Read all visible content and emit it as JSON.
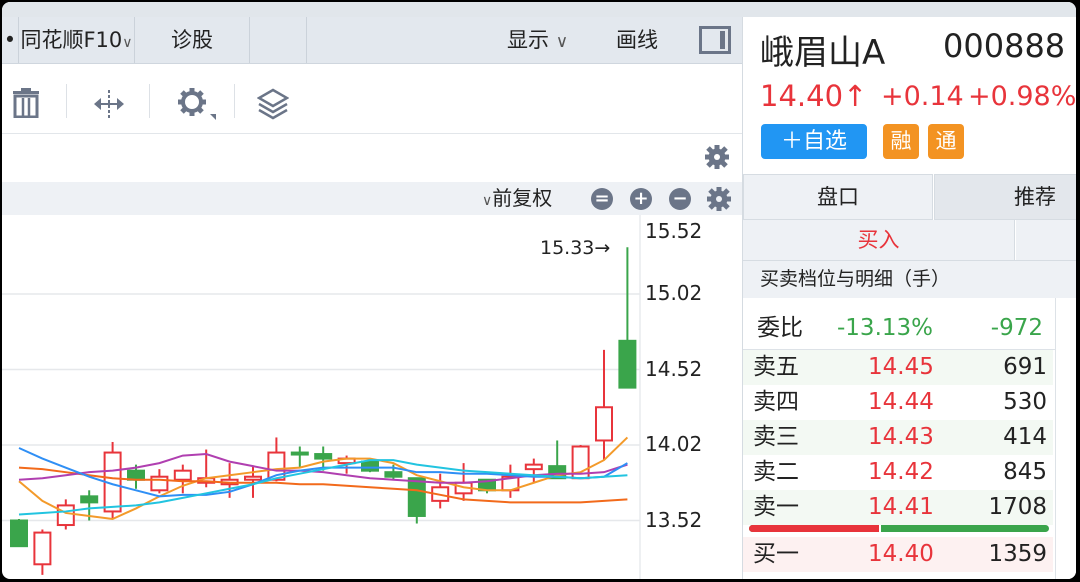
{
  "tabbar": {
    "dot": "•",
    "tabs": [
      "同花顺F10",
      "诊股"
    ],
    "f10_chevron": "∨",
    "display_label": "显示",
    "display_chevron": "∨",
    "draw_label": "画线"
  },
  "toolbar": {
    "icons": [
      "trash-icon",
      "split-arrows-icon",
      "gear-icon",
      "layers-icon"
    ]
  },
  "chart_header": {
    "adjust_label": "前复权",
    "adjust_chevron": "∨"
  },
  "chart_data": {
    "type": "candlestick",
    "y_ticks": [
      "15.52",
      "15.02",
      "14.52",
      "14.02",
      "13.52"
    ],
    "ylim": [
      13.2,
      15.6
    ],
    "max_annotation": "15.33→",
    "up_color": "#e8343b",
    "down_color": "#3aa54b",
    "candles": [
      {
        "o": 13.52,
        "c": 13.35,
        "h": 13.53,
        "l": 13.35
      },
      {
        "o": 13.23,
        "c": 13.44,
        "h": 13.46,
        "l": 13.16
      },
      {
        "o": 13.49,
        "c": 13.62,
        "h": 13.66,
        "l": 13.46
      },
      {
        "o": 13.68,
        "c": 13.64,
        "h": 13.72,
        "l": 13.52
      },
      {
        "o": 13.58,
        "c": 13.97,
        "h": 14.04,
        "l": 13.53
      },
      {
        "o": 13.85,
        "c": 13.79,
        "h": 13.89,
        "l": 13.73
      },
      {
        "o": 13.72,
        "c": 13.81,
        "h": 13.86,
        "l": 13.7
      },
      {
        "o": 13.79,
        "c": 13.85,
        "h": 13.89,
        "l": 13.7
      },
      {
        "o": 13.77,
        "c": 13.8,
        "h": 13.99,
        "l": 13.74
      },
      {
        "o": 13.76,
        "c": 13.79,
        "h": 13.9,
        "l": 13.67
      },
      {
        "o": 13.79,
        "c": 13.81,
        "h": 13.88,
        "l": 13.67
      },
      {
        "o": 13.79,
        "c": 13.97,
        "h": 14.07,
        "l": 13.78
      },
      {
        "o": 13.97,
        "c": 13.96,
        "h": 14.01,
        "l": 13.87
      },
      {
        "o": 13.96,
        "c": 13.93,
        "h": 14.01,
        "l": 13.85
      },
      {
        "o": 13.9,
        "c": 13.93,
        "h": 13.95,
        "l": 13.83
      },
      {
        "o": 13.91,
        "c": 13.85,
        "h": 13.93,
        "l": 13.84
      },
      {
        "o": 13.84,
        "c": 13.81,
        "h": 13.89,
        "l": 13.79
      },
      {
        "o": 13.8,
        "c": 13.55,
        "h": 13.8,
        "l": 13.5
      },
      {
        "o": 13.65,
        "c": 13.74,
        "h": 13.83,
        "l": 13.6
      },
      {
        "o": 13.7,
        "c": 13.77,
        "h": 13.9,
        "l": 13.65
      },
      {
        "o": 13.79,
        "c": 13.72,
        "h": 13.79,
        "l": 13.7
      },
      {
        "o": 13.72,
        "c": 13.81,
        "h": 13.89,
        "l": 13.67
      },
      {
        "o": 13.86,
        "c": 13.89,
        "h": 13.93,
        "l": 13.77
      },
      {
        "o": 13.88,
        "c": 13.8,
        "h": 14.05,
        "l": 13.8
      },
      {
        "o": 13.8,
        "c": 14.01,
        "h": 14.02,
        "l": 13.8
      },
      {
        "o": 14.05,
        "c": 14.27,
        "h": 14.65,
        "l": 13.92
      },
      {
        "o": 14.71,
        "c": 14.4,
        "h": 15.33,
        "l": 14.4
      }
    ],
    "lines": [
      {
        "color": "#f39a2a",
        "values": [
          13.78,
          13.65,
          13.57,
          13.55,
          13.53,
          13.6,
          13.68,
          13.75,
          13.8,
          13.82,
          13.84,
          13.86,
          13.87,
          13.91,
          13.93,
          13.93,
          13.9,
          13.82,
          13.78,
          13.74,
          13.72,
          13.72,
          13.77,
          13.82,
          13.84,
          13.92,
          14.07
        ]
      },
      {
        "color": "#f26a1b",
        "values": [
          13.87,
          13.86,
          13.84,
          13.82,
          13.8,
          13.79,
          13.79,
          13.78,
          13.78,
          13.77,
          13.77,
          13.77,
          13.76,
          13.76,
          13.75,
          13.74,
          13.73,
          13.72,
          13.69,
          13.66,
          13.65,
          13.64,
          13.64,
          13.64,
          13.64,
          13.65,
          13.66
        ]
      },
      {
        "color": "#b03fb0",
        "values": [
          13.79,
          13.8,
          13.82,
          13.84,
          13.85,
          13.87,
          13.9,
          13.95,
          13.96,
          13.91,
          13.88,
          13.85,
          13.85,
          13.84,
          13.82,
          13.8,
          13.79,
          13.78,
          13.77,
          13.77,
          13.78,
          13.8,
          13.82,
          13.83,
          13.83,
          13.84,
          13.89
        ]
      },
      {
        "color": "#2f8ff5",
        "values": [
          14.0,
          13.93,
          13.87,
          13.81,
          13.76,
          13.72,
          13.68,
          13.69,
          13.69,
          13.71,
          13.76,
          13.82,
          13.85,
          13.87,
          13.87,
          13.87,
          13.87,
          13.84,
          13.84,
          13.83,
          13.83,
          13.82,
          13.81,
          13.81,
          13.8,
          13.81,
          13.9
        ]
      },
      {
        "color": "#22c4e0",
        "values": [
          13.56,
          13.57,
          13.58,
          13.6,
          13.61,
          13.62,
          13.64,
          13.67,
          13.7,
          13.73,
          13.76,
          13.8,
          13.83,
          13.86,
          13.89,
          13.92,
          13.92,
          13.89,
          13.87,
          13.85,
          13.84,
          13.83,
          13.82,
          13.81,
          13.8,
          13.81,
          13.82
        ]
      }
    ]
  },
  "stock": {
    "name": "峨眉山A",
    "code": "000888",
    "price": "14.40↑",
    "change": "+0.14",
    "change_pct": "+0.98%",
    "watch_button": "＋自选",
    "badges": [
      "融",
      "通"
    ],
    "brand_blue": "#2196f3",
    "badge_orange": "#f39322"
  },
  "tabs": [
    "盘口",
    "推荐"
  ],
  "buy_label": "买入",
  "section_title": "买卖档位与明细（手）",
  "ratio": {
    "label": "委比",
    "pct": "-13.13%",
    "diff": "-972"
  },
  "asks": [
    {
      "name": "卖五",
      "price": "14.45",
      "vol": "691"
    },
    {
      "name": "卖四",
      "price": "14.44",
      "vol": "530"
    },
    {
      "name": "卖三",
      "price": "14.43",
      "vol": "414"
    },
    {
      "name": "卖二",
      "price": "14.42",
      "vol": "845"
    },
    {
      "name": "卖一",
      "price": "14.41",
      "vol": "1708"
    }
  ],
  "bid_ask_ratio": {
    "buy_fraction": 0.44
  },
  "bids": [
    {
      "name": "买一",
      "price": "14.40",
      "vol": "1359"
    }
  ]
}
